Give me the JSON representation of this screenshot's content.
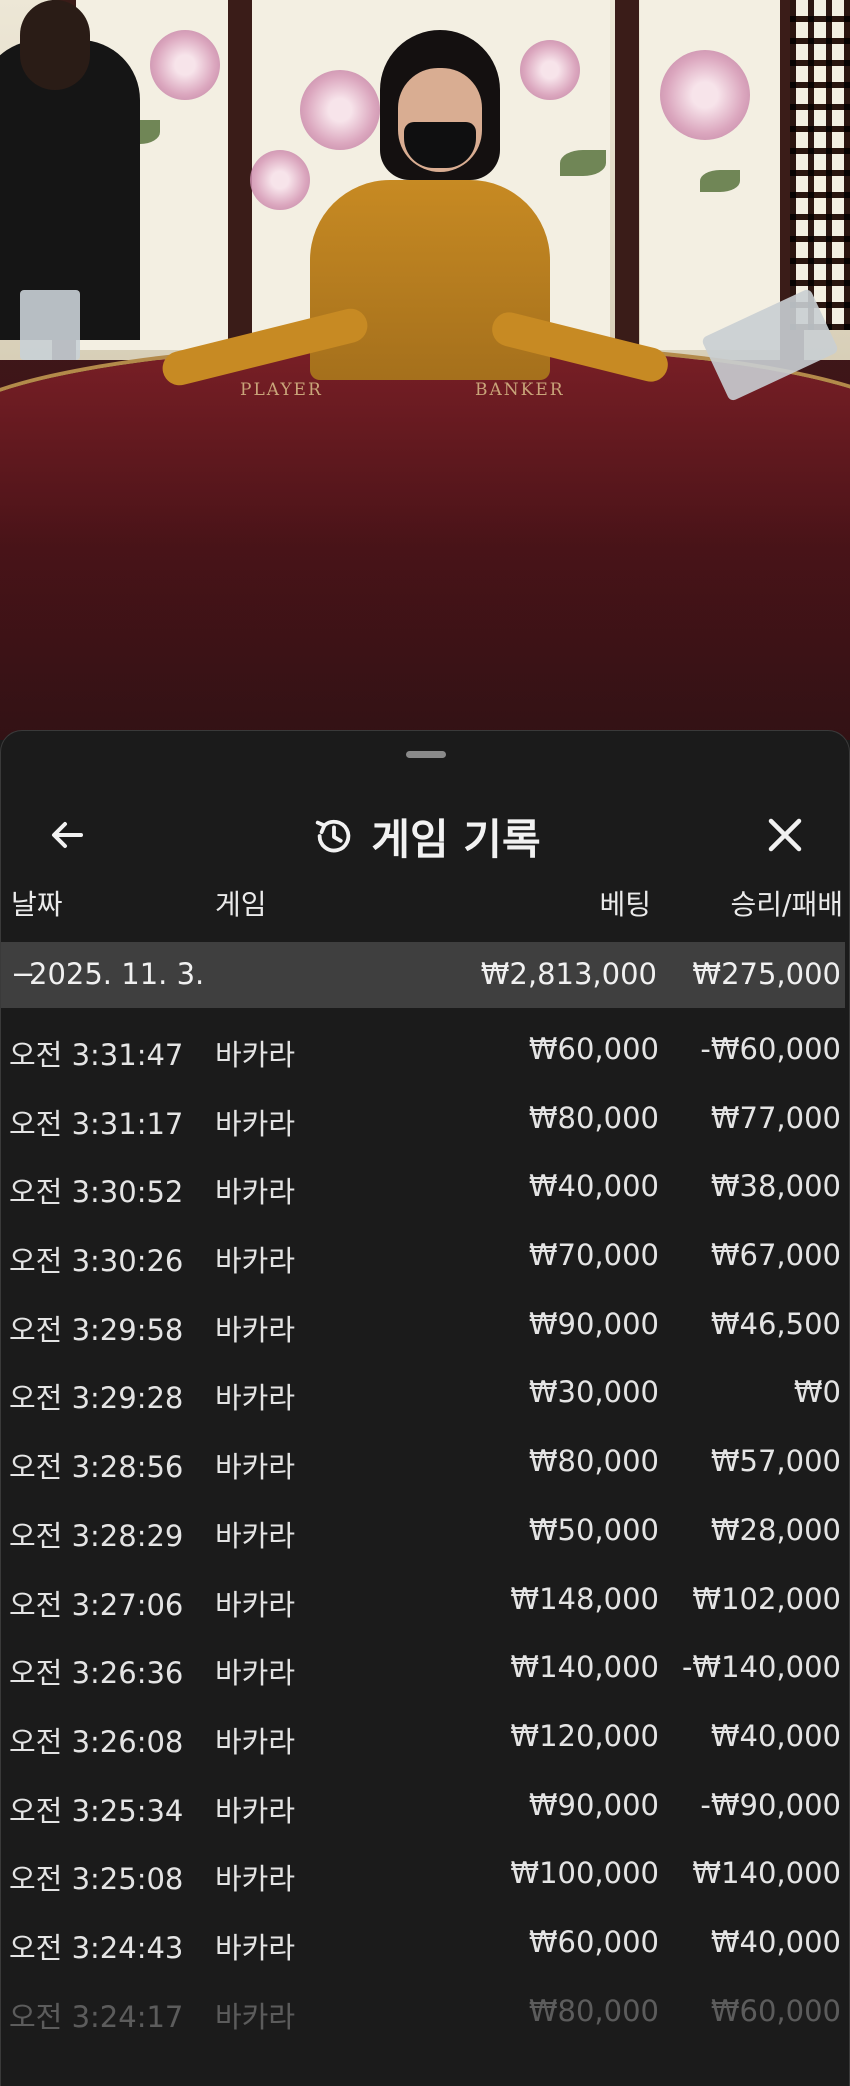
{
  "video": {
    "felt_labels": [
      "PLAYER",
      "BANKER"
    ]
  },
  "panel": {
    "title": "게임 기록",
    "icons": {
      "back": "arrow-left-icon",
      "history": "history-clock-icon",
      "close": "close-x-icon"
    }
  },
  "columns": {
    "date": "날짜",
    "game": "게임",
    "bet": "베팅",
    "result": "승리/패배"
  },
  "day_summary": {
    "toggle": "−",
    "date": "2025. 11. 3.",
    "bet": "₩2,813,000",
    "result": "₩275,000"
  },
  "rows": [
    {
      "time": "오전 3:31:47",
      "game": "바카라",
      "bet": "₩60,000",
      "result": "-₩60,000"
    },
    {
      "time": "오전 3:31:17",
      "game": "바카라",
      "bet": "₩80,000",
      "result": "₩77,000"
    },
    {
      "time": "오전 3:30:52",
      "game": "바카라",
      "bet": "₩40,000",
      "result": "₩38,000"
    },
    {
      "time": "오전 3:30:26",
      "game": "바카라",
      "bet": "₩70,000",
      "result": "₩67,000"
    },
    {
      "time": "오전 3:29:58",
      "game": "바카라",
      "bet": "₩90,000",
      "result": "₩46,500"
    },
    {
      "time": "오전 3:29:28",
      "game": "바카라",
      "bet": "₩30,000",
      "result": "₩0"
    },
    {
      "time": "오전 3:28:56",
      "game": "바카라",
      "bet": "₩80,000",
      "result": "₩57,000"
    },
    {
      "time": "오전 3:28:29",
      "game": "바카라",
      "bet": "₩50,000",
      "result": "₩28,000"
    },
    {
      "time": "오전 3:27:06",
      "game": "바카라",
      "bet": "₩148,000",
      "result": "₩102,000"
    },
    {
      "time": "오전 3:26:36",
      "game": "바카라",
      "bet": "₩140,000",
      "result": "-₩140,000"
    },
    {
      "time": "오전 3:26:08",
      "game": "바카라",
      "bet": "₩120,000",
      "result": "₩40,000"
    },
    {
      "time": "오전 3:25:34",
      "game": "바카라",
      "bet": "₩90,000",
      "result": "-₩90,000"
    },
    {
      "time": "오전 3:25:08",
      "game": "바카라",
      "bet": "₩100,000",
      "result": "₩140,000"
    },
    {
      "time": "오전 3:24:43",
      "game": "바카라",
      "bet": "₩60,000",
      "result": "₩40,000"
    },
    {
      "time": "오전 3:24:17",
      "game": "바카라",
      "bet": "₩80,000",
      "result": "₩60,000"
    }
  ]
}
